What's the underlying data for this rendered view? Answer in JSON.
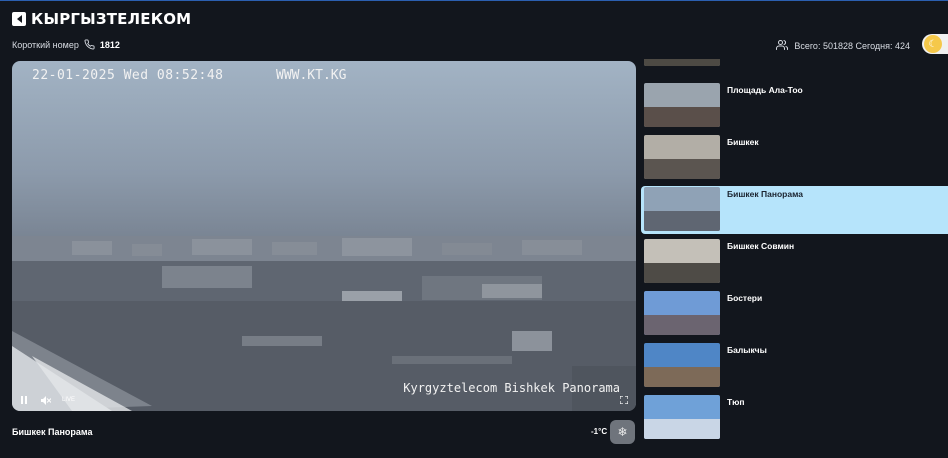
{
  "header": {
    "logo_text": "КЫРГЫЗТЕЛЕКОМ",
    "short_number_label": "Короткий номер",
    "short_number": "1812",
    "stats_text": "Всего: 501828 Сегодня: 424"
  },
  "player": {
    "osd_timestamp": "22-01-2025 Wed 08:52:48",
    "osd_site": "WWW.KT.KG",
    "osd_caption": "Kyrgyztelecom Bishkek Panorama",
    "live_label": "LIVE"
  },
  "below_player": {
    "camera_title": "Бишкек Панорама",
    "temperature": "-1°C"
  },
  "cameras": [
    {
      "label": "",
      "sky": "#8a8f95",
      "ground": "#4d4a44"
    },
    {
      "label": "Площадь Ала-Тоо",
      "sky": "#9aa4ae",
      "ground": "#5a4f4a"
    },
    {
      "label": "Бишкек",
      "sky": "#b2aea6",
      "ground": "#5b5550"
    },
    {
      "label": "Бишкек Панорама",
      "sky": "#8fa2b6",
      "ground": "#5f6672",
      "active": true
    },
    {
      "label": "Бишкек Совмин",
      "sky": "#c4c0b8",
      "ground": "#4e4b46"
    },
    {
      "label": "Бостери",
      "sky": "#6f9bd6",
      "ground": "#6b6470"
    },
    {
      "label": "Балыкчы",
      "sky": "#4f86c6",
      "ground": "#7d6a58"
    },
    {
      "label": "Тюп",
      "sky": "#6fa1d8",
      "ground": "#c9d6e6"
    }
  ],
  "colors": {
    "background": "#12161d",
    "active_item": "#b6e4fb",
    "theme_knob": "#f5c84a",
    "header_border": "#2b5fb0"
  }
}
